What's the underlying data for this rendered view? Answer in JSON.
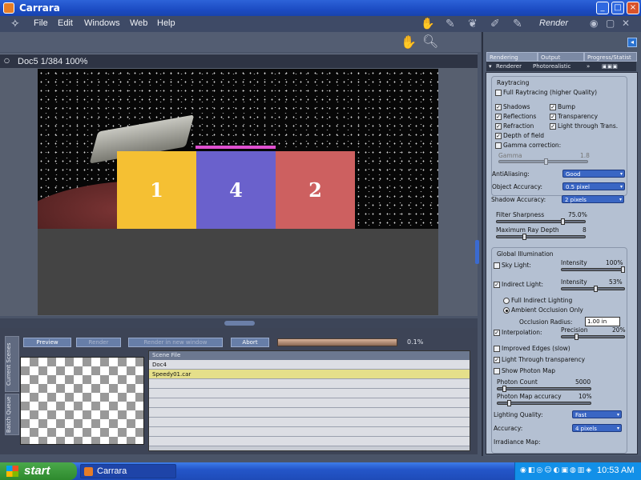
{
  "window": {
    "title": "Carrara",
    "controls": {
      "minimize": "_",
      "maximize": "□",
      "close": "×"
    }
  },
  "menu": {
    "items": [
      "File",
      "Edit",
      "Windows",
      "Web",
      "Help"
    ],
    "room_label": "Render"
  },
  "doc": {
    "info": "Doc5 1/384 100%"
  },
  "scene": {
    "boxes": [
      {
        "label": "1",
        "color": "#f5c033"
      },
      {
        "label": "4",
        "color": "#6a61cc"
      },
      {
        "label": "2",
        "color": "#cd6060"
      }
    ]
  },
  "batch": {
    "side_tabs": [
      "Current Scenes",
      "Batch Queue"
    ],
    "buttons": {
      "preview": "Preview",
      "render": "Render",
      "render_new_window": "Render in new window",
      "abort": "Abort"
    },
    "progress_fraction": 0.001,
    "progress_text": "0.1%",
    "file_header": "Scene File",
    "files": [
      "Doc4",
      "Speedy01.car"
    ],
    "selected_index": 1
  },
  "panel": {
    "tabs": [
      "Rendering",
      "Output",
      "Progress/Statist"
    ],
    "renderer_label": "Renderer",
    "renderer_value": "Photorealistic",
    "raytracing": {
      "title": "Raytracing",
      "full_raytracing": "Full Raytracing (higher Quality)",
      "shadows": "Shadows",
      "bump": "Bump",
      "reflections": "Reflections",
      "transparency": "Transparency",
      "refraction": "Refraction",
      "light_through_trans": "Light through Trans.",
      "depth_of_field": "Depth of field",
      "gamma_correction": "Gamma correction:",
      "gamma_label": "Gamma",
      "gamma_value": "1.8"
    },
    "antialiasing": {
      "label": "AntiAliasing:",
      "value": "Good"
    },
    "object_accuracy": {
      "label": "Object Accuracy:",
      "value": "0.5 pixel"
    },
    "shadow_accuracy": {
      "label": "Shadow Accuracy:",
      "value": "2 pixels"
    },
    "filter_sharpness": {
      "label": "Filter Sharpness",
      "value": "75.0%",
      "fraction": 0.75
    },
    "max_ray_depth": {
      "label": "Maximum Ray Depth",
      "value": "8",
      "fraction": 0.3
    },
    "gi": {
      "title": "Global Illumination",
      "sky_light": "Sky Light:",
      "sky_intensity_label": "Intensity",
      "sky_intensity": "100%",
      "indirect_light": "Indirect Light:",
      "indirect_intensity_label": "Intensity",
      "indirect_intensity": "53%",
      "full_indirect": "Full Indirect Lighting",
      "ambient_occlusion": "Ambient Occlusion Only",
      "occlusion_radius_label": "Occlusion Radius:",
      "occlusion_radius": "1.00 in",
      "interpolation": "Interpolation:",
      "precision_label": "Precision",
      "precision": "20%",
      "improved_edges": "Improved Edges (slow)",
      "light_through_transparency": "Light Through transparency",
      "show_photon_map": "Show Photon Map",
      "photon_count_label": "Photon Count",
      "photon_count": "5000",
      "photon_accuracy_label": "Photon Map accuracy",
      "photon_accuracy": "10%",
      "lighting_quality_label": "Lighting Quality:",
      "lighting_quality": "Fast",
      "accuracy_label": "Accuracy:",
      "accuracy": "4 pixels",
      "irradiance_label": "Irradiance Map:"
    }
  },
  "taskbar": {
    "start": "start",
    "task": "Carrara",
    "clock": "10:53 AM"
  }
}
